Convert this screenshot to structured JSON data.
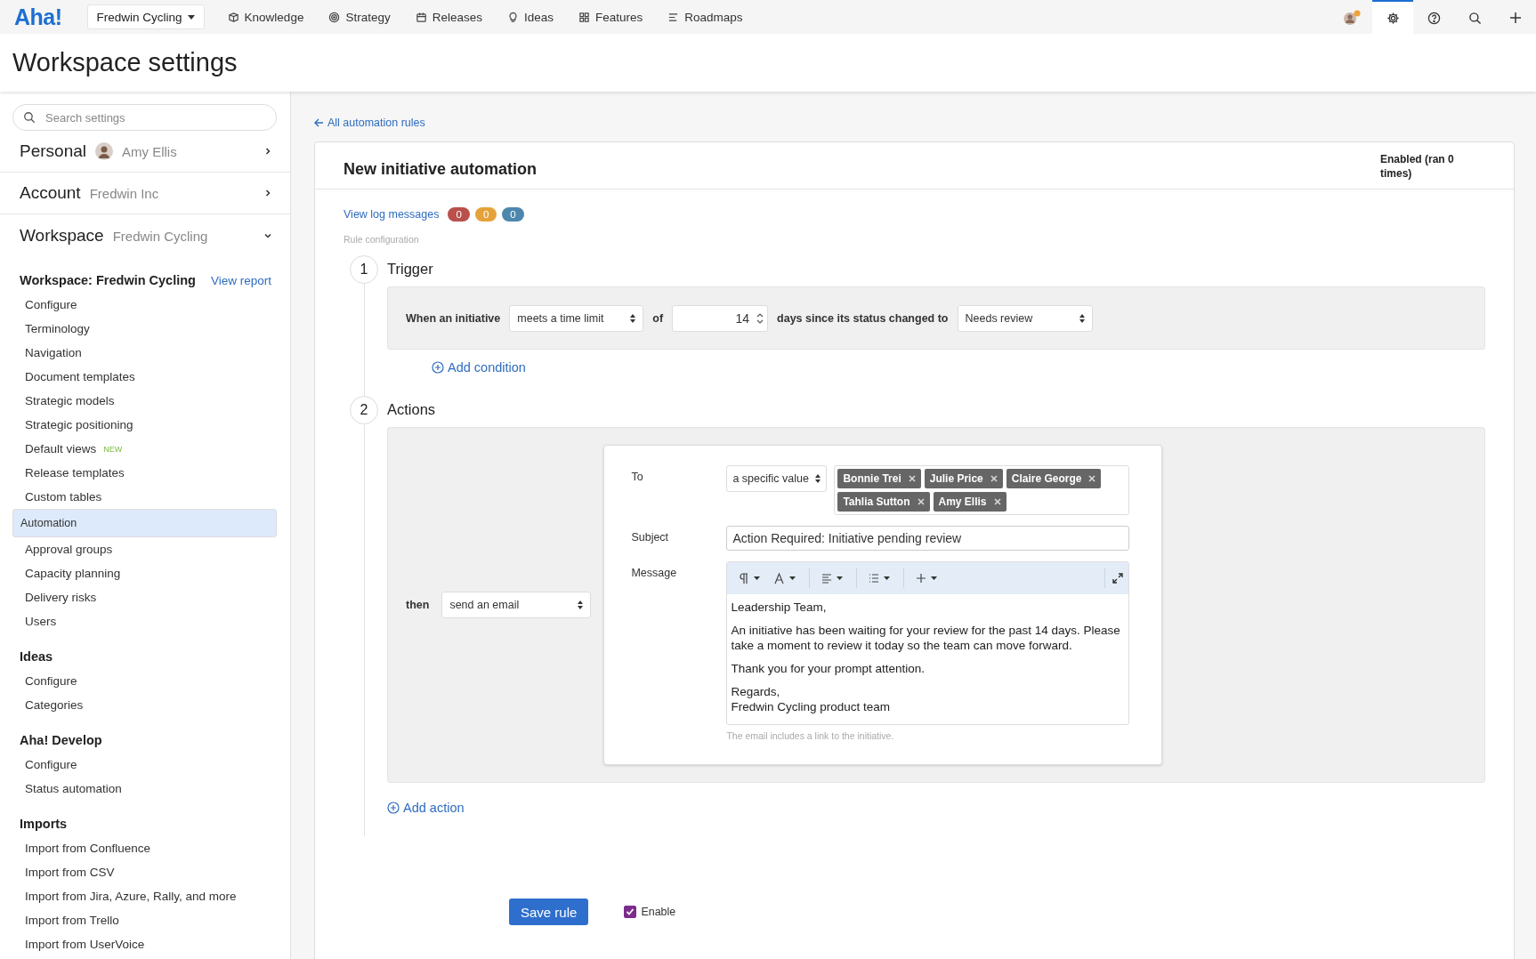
{
  "topbar": {
    "logo": "Aha!",
    "workspace_switcher": "Fredwin Cycling",
    "nav": [
      {
        "kind": "knowledge",
        "label": "Knowledge"
      },
      {
        "kind": "strategy",
        "label": "Strategy"
      },
      {
        "kind": "releases",
        "label": "Releases"
      },
      {
        "kind": "ideas",
        "label": "Ideas"
      },
      {
        "kind": "features",
        "label": "Features"
      },
      {
        "kind": "roadmaps",
        "label": "Roadmaps"
      }
    ],
    "tools": [
      {
        "kind": "avatar",
        "selected": false
      },
      {
        "kind": "settings",
        "selected": true
      },
      {
        "kind": "help",
        "selected": false
      },
      {
        "kind": "search",
        "selected": false
      },
      {
        "kind": "add",
        "selected": false
      }
    ]
  },
  "page_title": "Workspace settings",
  "sidebar": {
    "search": {
      "placeholder": "Search settings"
    },
    "sections": [
      {
        "title": "Personal",
        "subtitle": "Amy Ellis",
        "avatar": true,
        "expanded": false
      },
      {
        "title": "Account",
        "subtitle": "Fredwin Inc",
        "avatar": false,
        "expanded": false
      },
      {
        "title": "Workspace",
        "subtitle": "Fredwin Cycling",
        "avatar": false,
        "expanded": true
      }
    ],
    "groups": [
      {
        "title": "Workspace: Fredwin Cycling",
        "link": "View report",
        "items": [
          {
            "label": "Configure",
            "selected": false
          },
          {
            "label": "Terminology",
            "selected": false
          },
          {
            "label": "Navigation",
            "selected": false
          },
          {
            "label": "Document templates",
            "selected": false
          },
          {
            "label": "Strategic models",
            "selected": false
          },
          {
            "label": "Strategic positioning",
            "selected": false
          },
          {
            "label": "Default views",
            "badge": "NEW",
            "selected": false
          },
          {
            "label": "Release templates",
            "selected": false
          },
          {
            "label": "Custom tables",
            "selected": false
          },
          {
            "label": "Automation",
            "selected": true
          },
          {
            "label": "Approval groups",
            "selected": false
          },
          {
            "label": "Capacity planning",
            "selected": false
          },
          {
            "label": "Delivery risks",
            "selected": false
          },
          {
            "label": "Users",
            "selected": false
          }
        ]
      },
      {
        "title": "Ideas",
        "items": [
          {
            "label": "Configure",
            "selected": false
          },
          {
            "label": "Categories",
            "selected": false
          }
        ]
      },
      {
        "title": "Aha! Develop",
        "items": [
          {
            "label": "Configure",
            "selected": false
          },
          {
            "label": "Status automation",
            "selected": false
          }
        ]
      },
      {
        "title": "Imports",
        "items": [
          {
            "label": "Import from Confluence",
            "selected": false
          },
          {
            "label": "Import from CSV",
            "selected": false
          },
          {
            "label": "Import from Jira, Azure, Rally, and more",
            "selected": false
          },
          {
            "label": "Import from Trello",
            "selected": false
          },
          {
            "label": "Import from UserVoice",
            "selected": false
          }
        ]
      }
    ]
  },
  "back_link": "All automation rules",
  "rule": {
    "title": "New initiative automation",
    "status": "Enabled (ran 0 times)",
    "log_link": "View log messages",
    "log_counts": [
      {
        "text": "0",
        "color": "#b9504c"
      },
      {
        "text": "0",
        "color": "#e5a23a"
      },
      {
        "text": "0",
        "color": "#4d87ad"
      }
    ],
    "section_label": "Rule configuration",
    "trigger": {
      "number": "1",
      "title": "Trigger",
      "subject": "When an initiative",
      "condition": "meets a time limit",
      "of": "of",
      "days": "14",
      "tail": "days since its status changed to",
      "status": "Needs review",
      "add": "Add condition"
    },
    "actions": {
      "number": "2",
      "title": "Actions",
      "then": "then",
      "action": "send an email",
      "email": {
        "to_label": "To",
        "to_mode": "a specific value",
        "recipients": [
          "Bonnie Trei",
          "Julie Price",
          "Claire George",
          "Tahlia Sutton",
          "Amy Ellis"
        ],
        "subject_label": "Subject",
        "subject": "Action Required: Initiative pending review",
        "message_label": "Message",
        "toolbar": [
          {
            "kind": "paragraph"
          },
          {
            "kind": "font"
          },
          {
            "kind": "align"
          },
          {
            "kind": "list"
          },
          {
            "kind": "insert"
          }
        ],
        "paragraphs": [
          "Leadership Team,",
          "An initiative has been waiting for your review for the past 14 days. Please take a moment to review it today so the team can move forward.",
          "Thank you for your prompt attention.",
          "Regards,\nFredwin Cycling product team"
        ],
        "hint": "The email includes a link to the initiative."
      },
      "add": "Add action"
    },
    "save": "Save rule",
    "enable": {
      "label": "Enable",
      "checked": true
    }
  }
}
